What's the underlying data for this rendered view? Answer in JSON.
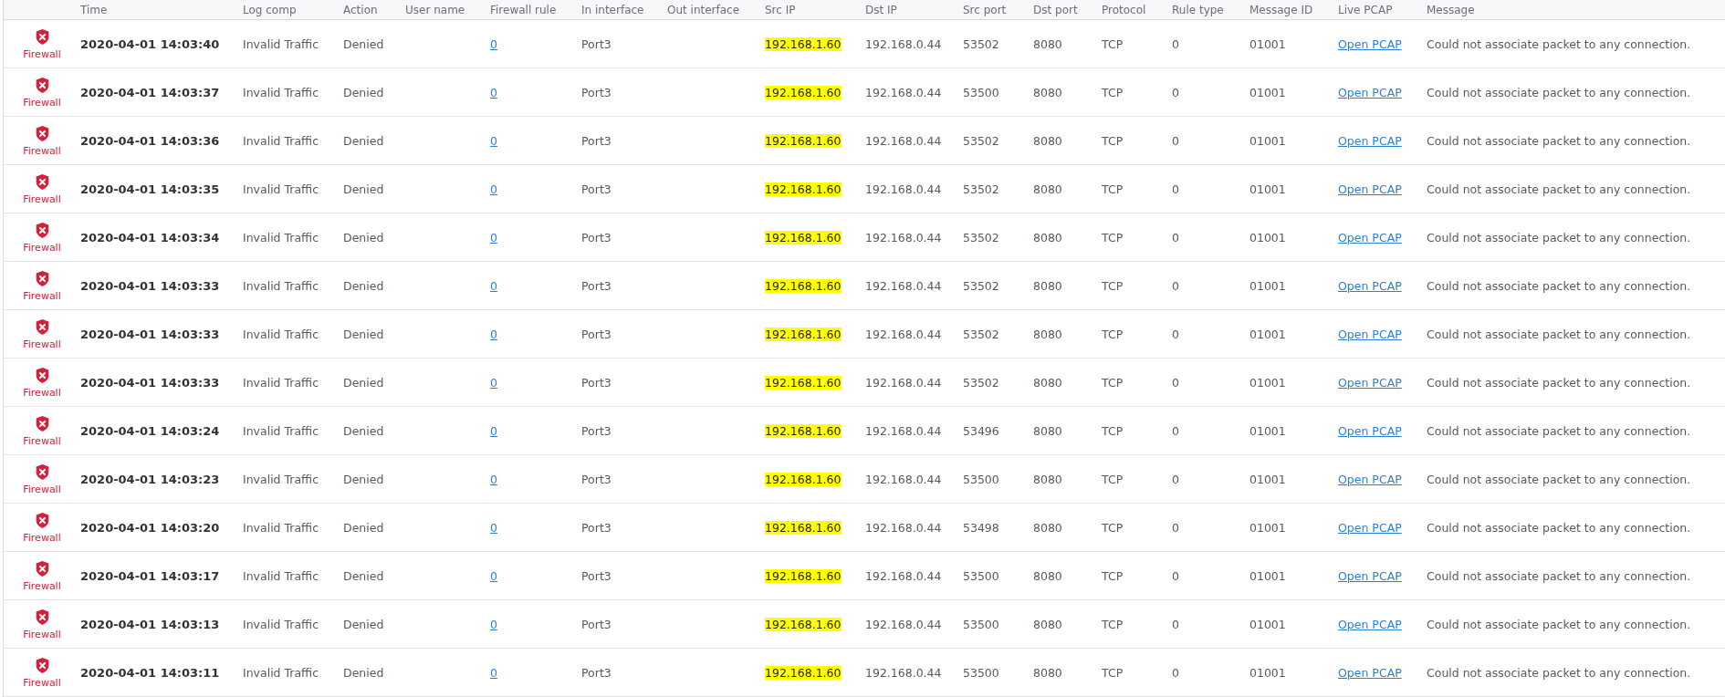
{
  "table": {
    "columns": [
      "Time",
      "Log comp",
      "Action",
      "User name",
      "Firewall rule",
      "In interface",
      "Out interface",
      "Src IP",
      "Dst IP",
      "Src port",
      "Dst port",
      "Protocol",
      "Rule type",
      "Message ID",
      "Live PCAP",
      "Message"
    ],
    "rows": [
      {
        "module": "Firewall",
        "time": "2020-04-01 14:03:40",
        "log_comp": "Invalid Traffic",
        "action": "Denied",
        "firewall_rule": "0",
        "in_interface": "Port3",
        "src_ip": "192.168.1.60",
        "src_ip_highlighted": true,
        "dst_ip": "192.168.0.44",
        "src_port": "53502",
        "dst_port": "8080",
        "protocol": "TCP",
        "rule_type": "0",
        "message_id": "01001",
        "live_pcap": "Open PCAP",
        "message": "Could not associate packet to any connection."
      },
      {
        "module": "Firewall",
        "time": "2020-04-01 14:03:37",
        "log_comp": "Invalid Traffic",
        "action": "Denied",
        "firewall_rule": "0",
        "in_interface": "Port3",
        "src_ip": "192.168.1.60",
        "src_ip_highlighted": true,
        "dst_ip": "192.168.0.44",
        "src_port": "53500",
        "dst_port": "8080",
        "protocol": "TCP",
        "rule_type": "0",
        "message_id": "01001",
        "live_pcap": "Open PCAP",
        "message": "Could not associate packet to any connection."
      },
      {
        "module": "Firewall",
        "time": "2020-04-01 14:03:36",
        "log_comp": "Invalid Traffic",
        "action": "Denied",
        "firewall_rule": "0",
        "in_interface": "Port3",
        "src_ip": "192.168.1.60",
        "src_ip_highlighted": true,
        "dst_ip": "192.168.0.44",
        "src_port": "53502",
        "dst_port": "8080",
        "protocol": "TCP",
        "rule_type": "0",
        "message_id": "01001",
        "live_pcap": "Open PCAP",
        "message": "Could not associate packet to any connection."
      },
      {
        "module": "Firewall",
        "time": "2020-04-01 14:03:35",
        "log_comp": "Invalid Traffic",
        "action": "Denied",
        "firewall_rule": "0",
        "in_interface": "Port3",
        "src_ip": "192.168.1.60",
        "src_ip_highlighted": true,
        "dst_ip": "192.168.0.44",
        "src_port": "53502",
        "dst_port": "8080",
        "protocol": "TCP",
        "rule_type": "0",
        "message_id": "01001",
        "live_pcap": "Open PCAP",
        "message": "Could not associate packet to any connection."
      },
      {
        "module": "Firewall",
        "time": "2020-04-01 14:03:34",
        "log_comp": "Invalid Traffic",
        "action": "Denied",
        "firewall_rule": "0",
        "in_interface": "Port3",
        "src_ip": "192.168.1.60",
        "src_ip_highlighted": true,
        "dst_ip": "192.168.0.44",
        "src_port": "53502",
        "dst_port": "8080",
        "protocol": "TCP",
        "rule_type": "0",
        "message_id": "01001",
        "live_pcap": "Open PCAP",
        "message": "Could not associate packet to any connection."
      },
      {
        "module": "Firewall",
        "time": "2020-04-01 14:03:33",
        "log_comp": "Invalid Traffic",
        "action": "Denied",
        "firewall_rule": "0",
        "in_interface": "Port3",
        "src_ip": "192.168.1.60",
        "src_ip_highlighted": true,
        "dst_ip": "192.168.0.44",
        "src_port": "53502",
        "dst_port": "8080",
        "protocol": "TCP",
        "rule_type": "0",
        "message_id": "01001",
        "live_pcap": "Open PCAP",
        "message": "Could not associate packet to any connection."
      },
      {
        "module": "Firewall",
        "time": "2020-04-01 14:03:33",
        "log_comp": "Invalid Traffic",
        "action": "Denied",
        "firewall_rule": "0",
        "in_interface": "Port3",
        "src_ip": "192.168.1.60",
        "src_ip_highlighted": true,
        "dst_ip": "192.168.0.44",
        "src_port": "53502",
        "dst_port": "8080",
        "protocol": "TCP",
        "rule_type": "0",
        "message_id": "01001",
        "live_pcap": "Open PCAP",
        "message": "Could not associate packet to any connection."
      },
      {
        "module": "Firewall",
        "time": "2020-04-01 14:03:33",
        "log_comp": "Invalid Traffic",
        "action": "Denied",
        "firewall_rule": "0",
        "in_interface": "Port3",
        "src_ip": "192.168.1.60",
        "src_ip_highlighted": true,
        "dst_ip": "192.168.0.44",
        "src_port": "53502",
        "dst_port": "8080",
        "protocol": "TCP",
        "rule_type": "0",
        "message_id": "01001",
        "live_pcap": "Open PCAP",
        "message": "Could not associate packet to any connection."
      },
      {
        "module": "Firewall",
        "time": "2020-04-01 14:03:24",
        "log_comp": "Invalid Traffic",
        "action": "Denied",
        "firewall_rule": "0",
        "in_interface": "Port3",
        "src_ip": "192.168.1.60",
        "src_ip_highlighted": true,
        "dst_ip": "192.168.0.44",
        "src_port": "53496",
        "dst_port": "8080",
        "protocol": "TCP",
        "rule_type": "0",
        "message_id": "01001",
        "live_pcap": "Open PCAP",
        "message": "Could not associate packet to any connection."
      },
      {
        "module": "Firewall",
        "time": "2020-04-01 14:03:23",
        "log_comp": "Invalid Traffic",
        "action": "Denied",
        "firewall_rule": "0",
        "in_interface": "Port3",
        "src_ip": "192.168.1.60",
        "src_ip_highlighted": true,
        "dst_ip": "192.168.0.44",
        "src_port": "53500",
        "dst_port": "8080",
        "protocol": "TCP",
        "rule_type": "0",
        "message_id": "01001",
        "live_pcap": "Open PCAP",
        "message": "Could not associate packet to any connection."
      },
      {
        "module": "Firewall",
        "time": "2020-04-01 14:03:20",
        "log_comp": "Invalid Traffic",
        "action": "Denied",
        "firewall_rule": "0",
        "in_interface": "Port3",
        "src_ip": "192.168.1.60",
        "src_ip_highlighted": true,
        "dst_ip": "192.168.0.44",
        "src_port": "53498",
        "dst_port": "8080",
        "protocol": "TCP",
        "rule_type": "0",
        "message_id": "01001",
        "live_pcap": "Open PCAP",
        "message": "Could not associate packet to any connection."
      },
      {
        "module": "Firewall",
        "time": "2020-04-01 14:03:17",
        "log_comp": "Invalid Traffic",
        "action": "Denied",
        "firewall_rule": "0",
        "in_interface": "Port3",
        "src_ip": "192.168.1.60",
        "src_ip_highlighted": true,
        "dst_ip": "192.168.0.44",
        "src_port": "53500",
        "dst_port": "8080",
        "protocol": "TCP",
        "rule_type": "0",
        "message_id": "01001",
        "live_pcap": "Open PCAP",
        "message": "Could not associate packet to any connection."
      },
      {
        "module": "Firewall",
        "time": "2020-04-01 14:03:13",
        "log_comp": "Invalid Traffic",
        "action": "Denied",
        "firewall_rule": "0",
        "in_interface": "Port3",
        "src_ip": "192.168.1.60",
        "src_ip_highlighted": true,
        "dst_ip": "192.168.0.44",
        "src_port": "53500",
        "dst_port": "8080",
        "protocol": "TCP",
        "rule_type": "0",
        "message_id": "01001",
        "live_pcap": "Open PCAP",
        "message": "Could not associate packet to any connection."
      },
      {
        "module": "Firewall",
        "time": "2020-04-01 14:03:11",
        "log_comp": "Invalid Traffic",
        "action": "Denied",
        "firewall_rule": "0",
        "in_interface": "Port3",
        "src_ip": "192.168.1.60",
        "src_ip_highlighted": true,
        "dst_ip": "192.168.0.44",
        "src_port": "53500",
        "dst_port": "8080",
        "protocol": "TCP",
        "rule_type": "0",
        "message_id": "01001",
        "live_pcap": "Open PCAP",
        "message": "Could not associate packet to any connection."
      }
    ]
  }
}
